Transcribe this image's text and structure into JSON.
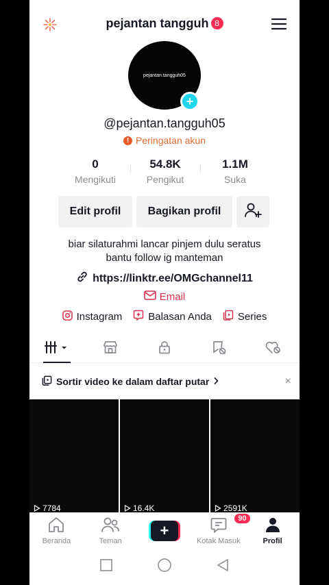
{
  "header": {
    "title": "pejantan tangguh",
    "badge": "8"
  },
  "profile": {
    "avatar_text": "pejantan.tangguh05",
    "username": "@pejantan.tangguh05",
    "warning": "Peringatan akun"
  },
  "stats": [
    {
      "value": "0",
      "label": "Mengikuti"
    },
    {
      "value": "54.8K",
      "label": "Pengikut"
    },
    {
      "value": "1.1M",
      "label": "Suka"
    }
  ],
  "buttons": {
    "edit": "Edit profil",
    "share": "Bagikan profil"
  },
  "bio": {
    "line1": "biar silaturahmi lancar pinjem dulu seratus",
    "line2": "bantu follow ig manteman"
  },
  "link": "https://linktr.ee/OMGchannel11",
  "email": "Email",
  "extras": {
    "instagram": "Instagram",
    "replies": "Balasan Anda",
    "series": "Series"
  },
  "sort_bar": {
    "text": "Sortir video ke dalam daftar putar",
    "close": "×"
  },
  "videos": [
    {
      "views": "7784"
    },
    {
      "views": "16.4K"
    },
    {
      "views": "2591K"
    }
  ],
  "nav": {
    "home": "Beranda",
    "friends": "Teman",
    "inbox": "Kotak Masuk",
    "inbox_badge": "90",
    "profile": "Profil"
  },
  "colors": {
    "accent": "#fe2c55",
    "cyan": "#25f4ee",
    "warning": "#e06a33",
    "email": "#d6304a"
  }
}
